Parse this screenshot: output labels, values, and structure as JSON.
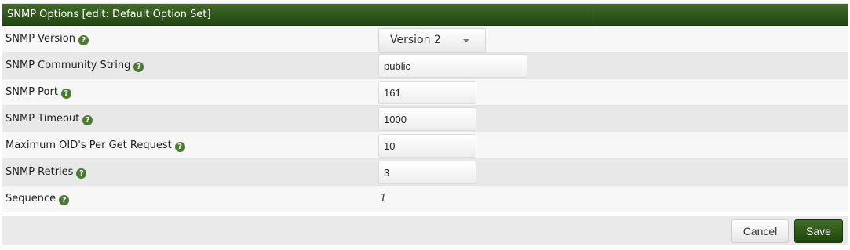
{
  "panel": {
    "title": "SNMP Options [edit: Default Option Set]"
  },
  "help_glyph": "?",
  "fields": {
    "snmp_version": {
      "label": "SNMP Version",
      "value": "Version 2"
    },
    "community": {
      "label": "SNMP Community String",
      "value": "public"
    },
    "port": {
      "label": "SNMP Port",
      "value": "161"
    },
    "timeout": {
      "label": "SNMP Timeout",
      "value": "1000"
    },
    "max_oids": {
      "label": "Maximum OID's Per Get Request",
      "value": "10"
    },
    "retries": {
      "label": "SNMP Retries",
      "value": "3"
    },
    "sequence": {
      "label": "Sequence",
      "value": "1"
    }
  },
  "actions": {
    "cancel_label": "Cancel",
    "save_label": "Save"
  },
  "colors": {
    "header_bg": "#2f5a1c",
    "save_bg": "#2c5519",
    "help_icon": "#4b7a32"
  }
}
